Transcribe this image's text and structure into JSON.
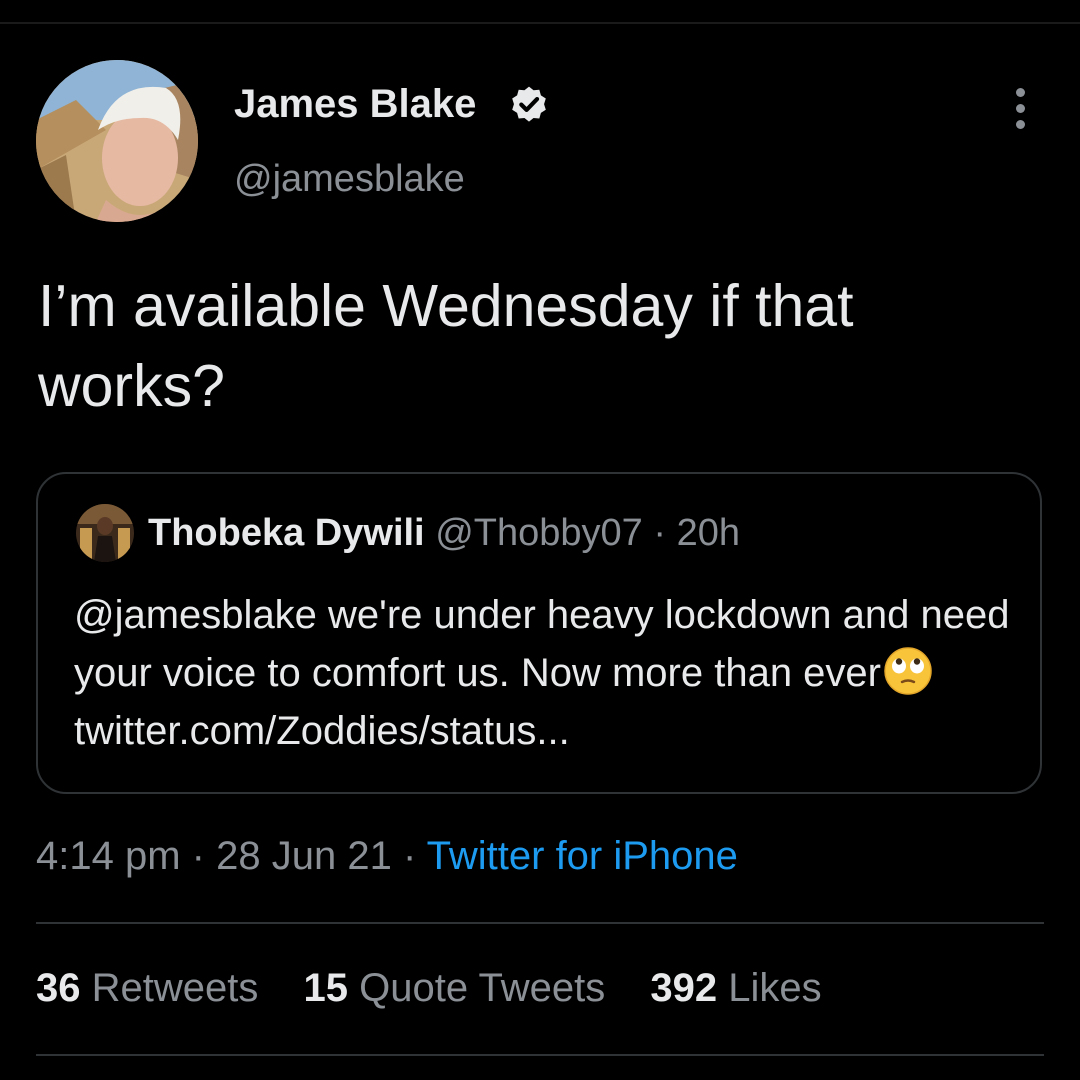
{
  "tweet": {
    "author_name": "James Blake",
    "author_handle": "@jamesblake",
    "text": "I’m available Wednesday if that works?",
    "time": "4:14 pm",
    "date": "28 Jun 21",
    "separator": "·",
    "source": "Twitter for iPhone"
  },
  "quote": {
    "author_name": "Thobeka Dywili",
    "author_handle": "@Thobby07",
    "separator": "·",
    "age": "20h",
    "text": "@jamesblake we're under heavy lockdown and need your voice to comfort us. Now more than ever",
    "emoji": "face-with-rolling-eyes",
    "link": "twitter.com/Zoddies/status..."
  },
  "stats": [
    {
      "count": "36",
      "label": "Retweets"
    },
    {
      "count": "15",
      "label": "Quote Tweets"
    },
    {
      "count": "392",
      "label": "Likes"
    }
  ],
  "colors": {
    "background": "#000000",
    "primary_text": "#e7e9ea",
    "secondary_text": "#8b9096",
    "link": "#1d9bf0",
    "border": "#2f3336",
    "verified_badge": "#e7e9ea"
  }
}
